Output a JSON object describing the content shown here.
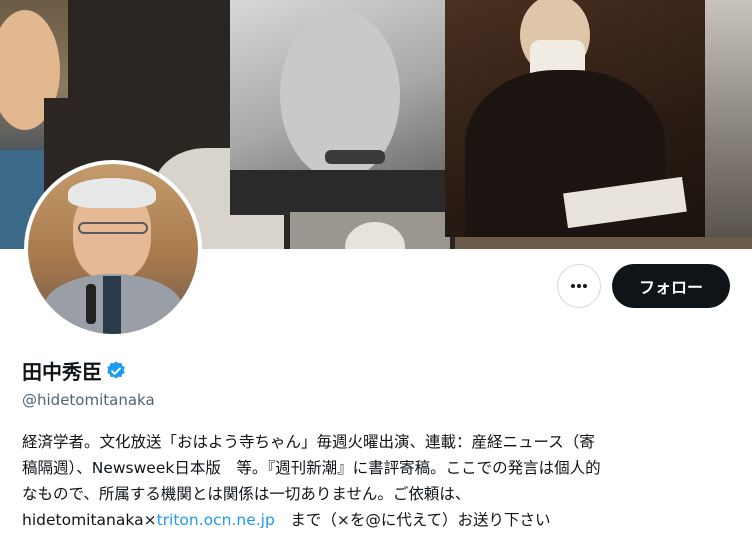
{
  "profile": {
    "display_name": "田中秀臣",
    "handle": "@hidetomitanaka",
    "verified": true,
    "bio": {
      "line1": "経済学者。文化放送「おはよう寺ちゃん」毎週火曜出演、連載：産経ニュース（寄",
      "line2": "稿隔週）、Newsweek日本版　等。『週刊新潮』に書評寄稿。ここでの発言は個人的",
      "line3": "なもので、所属する機関とは関係は一切ありません。ご依頼は、",
      "line4_prefix": "hidetomitanaka×",
      "line4_link": "triton.ocn.ne.jp",
      "line4_suffix": "　まで（×を@に代えて）お送り下さい"
    }
  },
  "actions": {
    "more_icon": "more-horizontal-icon",
    "follow_label": "フォロー"
  },
  "colors": {
    "follow_bg": "#0f1419",
    "verified": "#1d9bf0",
    "link": "#1d9bf0",
    "handle": "#536471"
  }
}
